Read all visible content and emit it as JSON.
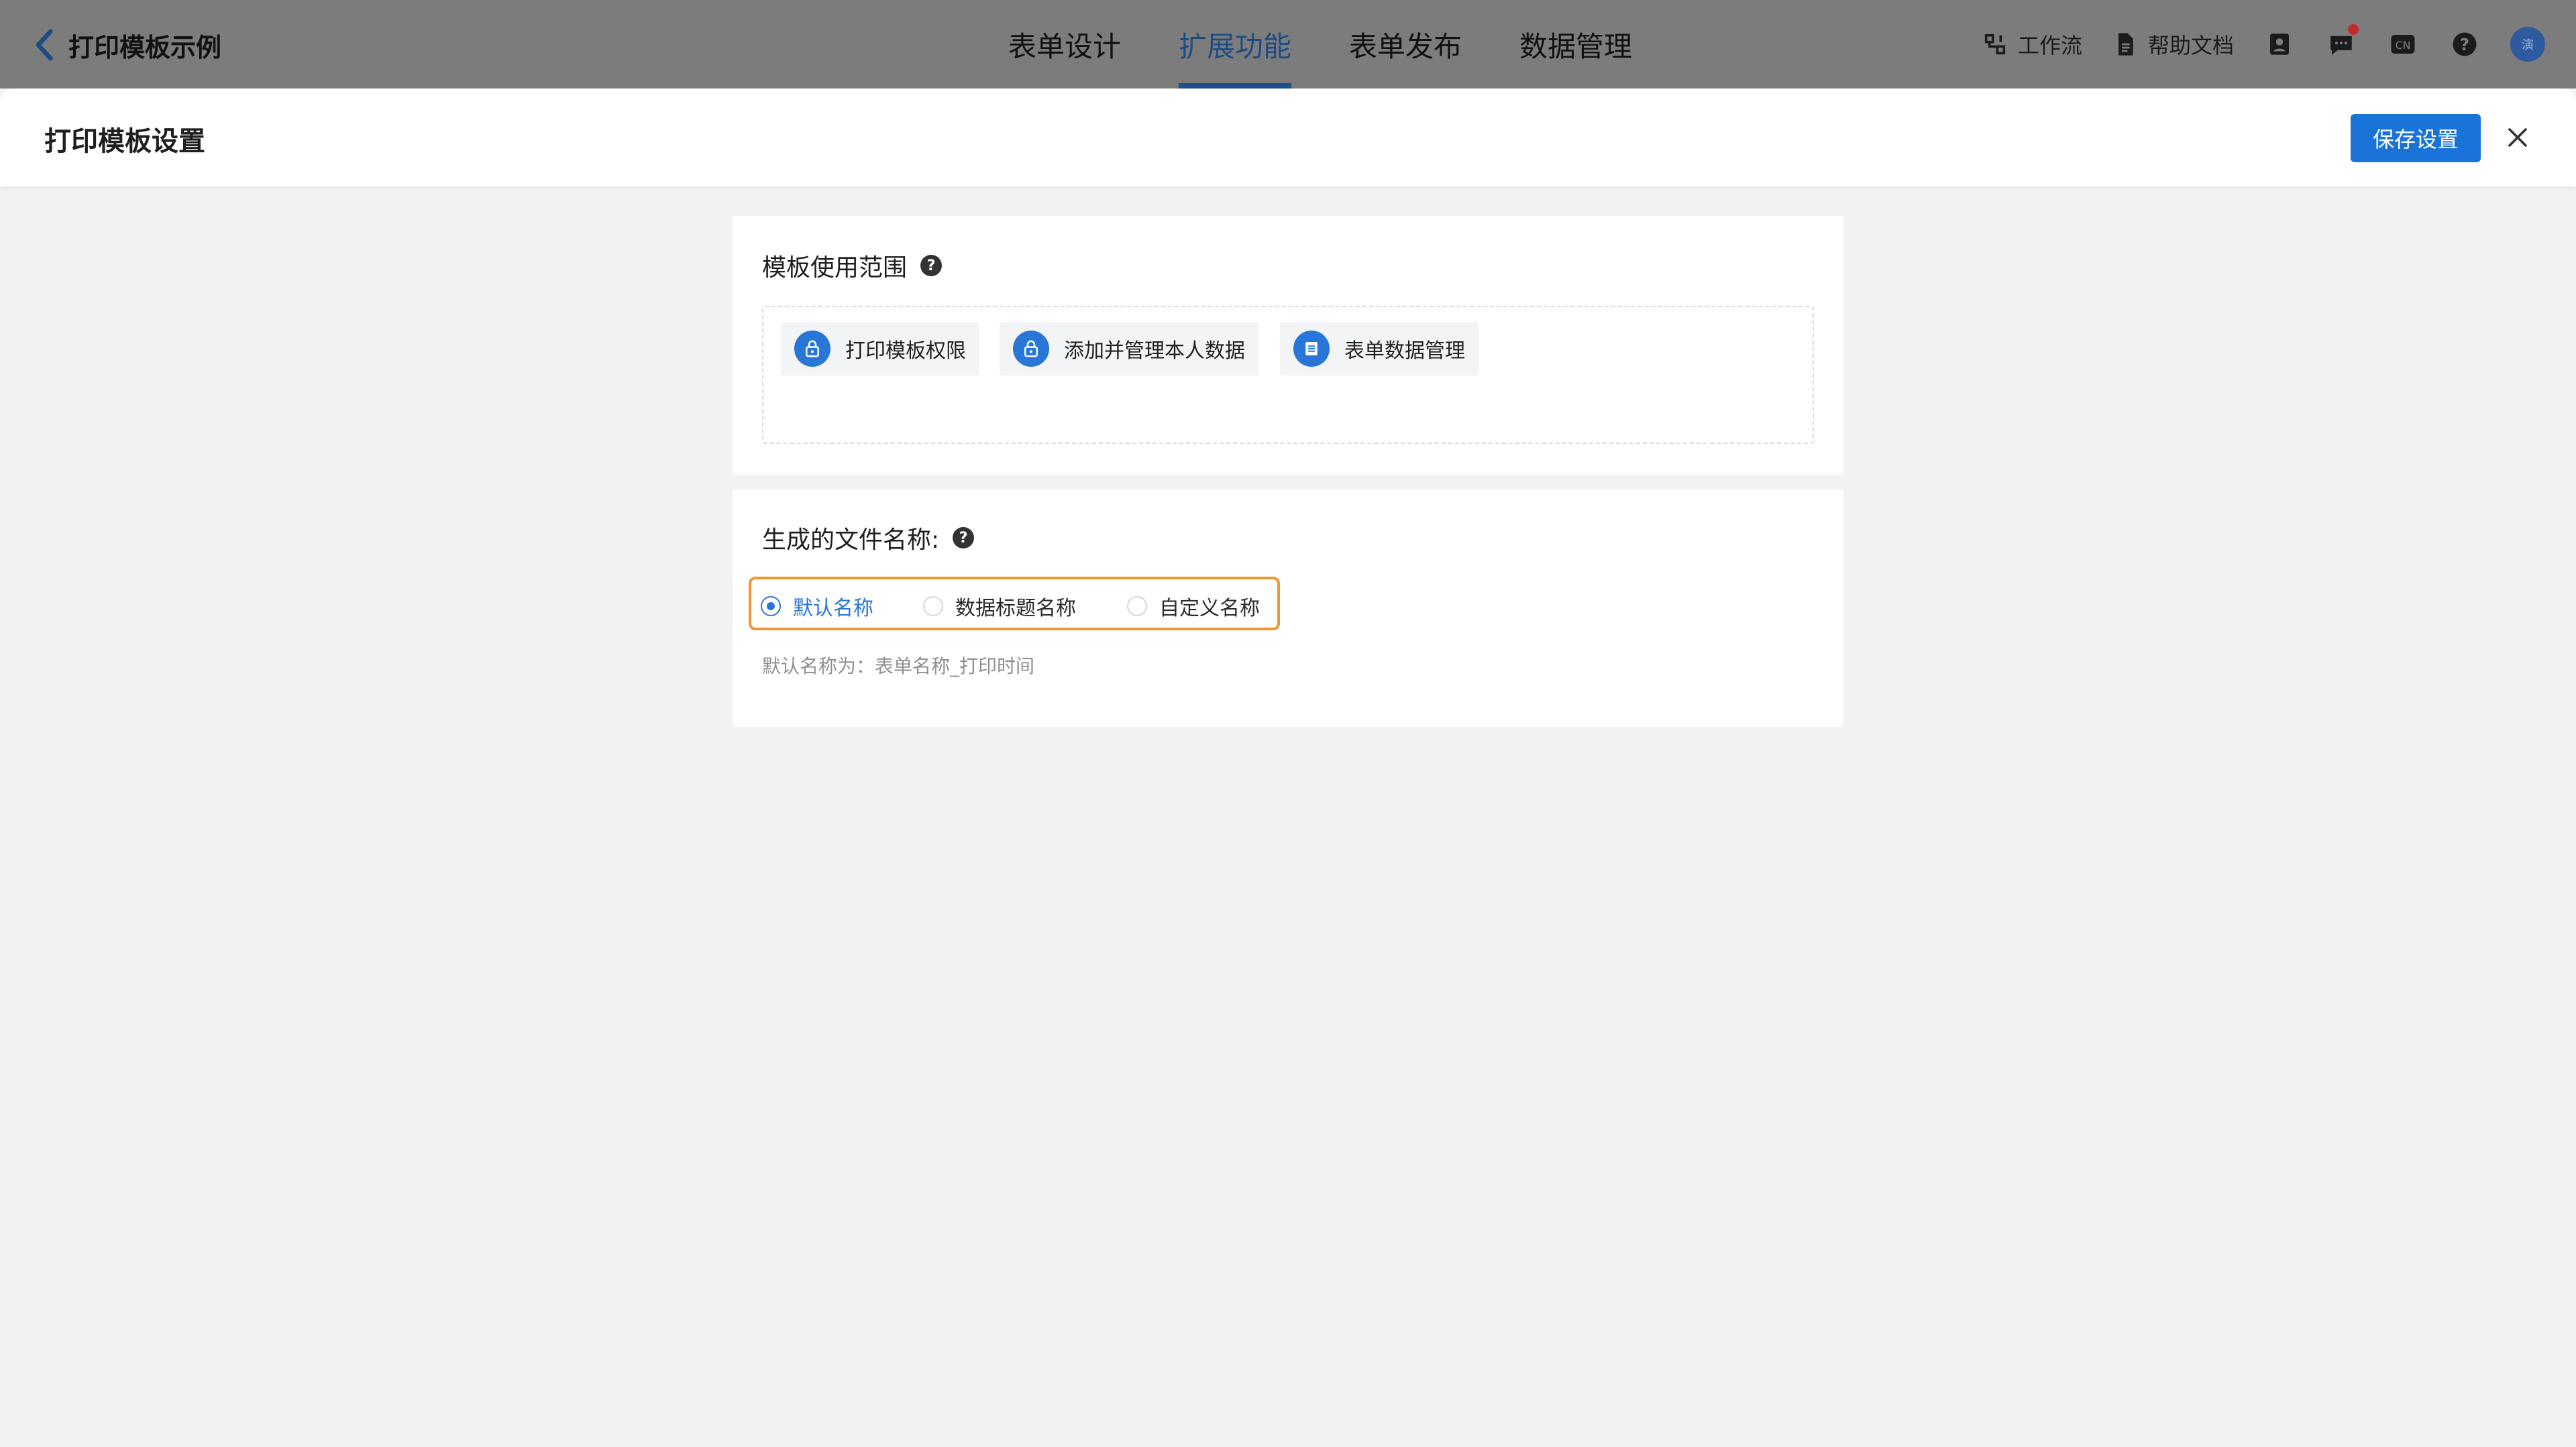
{
  "header": {
    "back_label": "打印模板示例",
    "tabs": [
      {
        "label": "表单设计"
      },
      {
        "label": "扩展功能",
        "active": true
      },
      {
        "label": "表单发布"
      },
      {
        "label": "数据管理"
      }
    ],
    "tools": {
      "workflow_label": "工作流",
      "help_docs_label": "帮助文档",
      "language_label": "CN",
      "avatar_label": "演"
    }
  },
  "drawer": {
    "title": "打印模板设置",
    "save_label": "保存设置"
  },
  "scope_section": {
    "title": "模板使用范围",
    "help": "?",
    "chips": [
      {
        "label": "打印模板权限",
        "icon": "lock-icon"
      },
      {
        "label": "添加并管理本人数据",
        "icon": "lock-icon"
      },
      {
        "label": "表单数据管理",
        "icon": "list-icon"
      }
    ]
  },
  "filename_section": {
    "title": "生成的文件名称:",
    "help": "?",
    "options": [
      {
        "label": "默认名称",
        "checked": true
      },
      {
        "label": "数据标题名称",
        "checked": false
      },
      {
        "label": "自定义名称",
        "checked": false
      }
    ],
    "hint": "默认名称为：表单名称_打印时间"
  },
  "colors": {
    "primary": "#1a73d8",
    "highlight_border": "#f0962d",
    "overlay_topbar": "#7c7c7c"
  }
}
